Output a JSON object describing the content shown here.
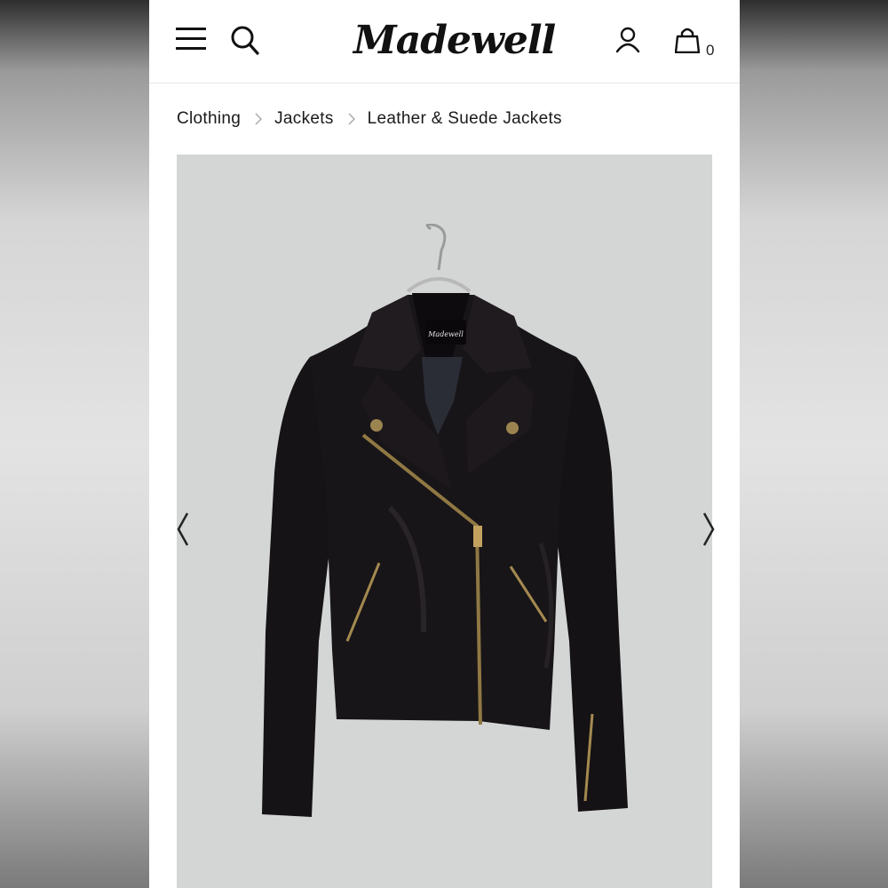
{
  "header": {
    "brand": "Madewell",
    "menu_icon": "hamburger-menu-icon",
    "search_icon": "search-icon",
    "account_icon": "user-icon",
    "bag_icon": "shopping-bag-icon",
    "bag_count": "0"
  },
  "breadcrumb": [
    {
      "label": "Clothing"
    },
    {
      "label": "Jackets"
    },
    {
      "label": "Leather & Suede Jackets"
    }
  ],
  "product": {
    "image_label": "Madewell",
    "image_description_icon": "black-leather-moto-jacket-image"
  },
  "carousel": {
    "prev_icon": "chevron-left-icon",
    "next_icon": "chevron-right-icon"
  },
  "colors": {
    "background_gray": "#d4d6d5",
    "text": "#1a1a1a",
    "leather": "#141214",
    "zipper": "#b89a55"
  }
}
